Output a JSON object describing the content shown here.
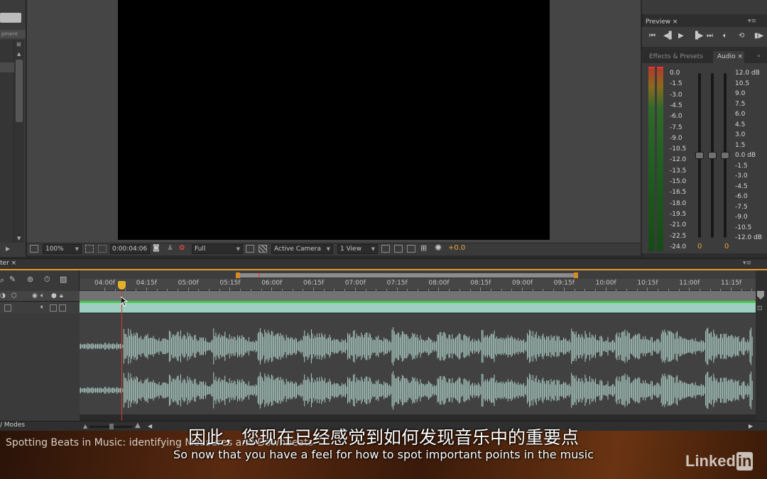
{
  "left_panel": {
    "column_header": "pment"
  },
  "viewer_bar": {
    "magnification": "100%",
    "timecode": "0:00:04:06",
    "resolution": "Full",
    "camera": "Active Camera",
    "view_layout": "1 View",
    "exposure": "+0.0"
  },
  "preview_panel": {
    "tab_label": "Preview ×",
    "menu": "▾≡",
    "controls": [
      "first-frame-icon",
      "prev-frame-icon",
      "play-icon",
      "next-frame-icon",
      "last-frame-icon",
      "audio-icon",
      "loop-icon",
      "ram-preview-icon"
    ]
  },
  "audio_panel": {
    "tab_effects": "Effects & Presets",
    "tab_audio": "Audio ×",
    "left_scale": [
      "0.0",
      "-1.5",
      "-3.0",
      "-4.5",
      "-6.0",
      "-7.5",
      "-9.0",
      "-10.5",
      "-12.0",
      "-13.5",
      "-15.0",
      "-16.5",
      "-18.0",
      "-19.5",
      "-21.0",
      "-22.5",
      "-24.0"
    ],
    "right_scale": [
      "12.0 dB",
      "10.5",
      "9.0",
      "7.5",
      "6.0",
      "4.5",
      "3.0",
      "1.5",
      "0.0 dB",
      "-1.5",
      "-3.0",
      "-4.5",
      "-6.0",
      "-7.5",
      "-9.0",
      "-10.5",
      "-12.0 dB"
    ],
    "left_value": "0",
    "right_value": "0",
    "colors": {
      "meter_green": "#2f6a2a",
      "meter_peak": "#e33333",
      "value_orange": "#e8a536"
    }
  },
  "timeline": {
    "tab_label": "ter ×",
    "menu": "▾≡",
    "ruler_ticks": [
      "04:00f",
      "04:15f",
      "05:00f",
      "05:15f",
      "06:00f",
      "06:15f",
      "07:00f",
      "07:15f",
      "08:00f",
      "08:15f",
      "09:00f",
      "09:15f",
      "10:00f",
      "10:15f",
      "11:00f",
      "11:15f"
    ],
    "modes_label": "/ Modes",
    "colors": {
      "audio_layer": "#9fcfc2",
      "waveform": "#b9dcd3",
      "playhead": "#d43b2c",
      "work_area": "#e79b2a"
    }
  },
  "overlay": {
    "course_title": "Spotting Beats in Music: identifying Measures and Downbeats",
    "subtitle_cn": "因此，您现在已经感觉到如何发现音乐中的重要点",
    "subtitle_en": "So now that you have a feel for how to spot important points in the music",
    "logo_text": "Linked",
    "logo_in": "in"
  }
}
